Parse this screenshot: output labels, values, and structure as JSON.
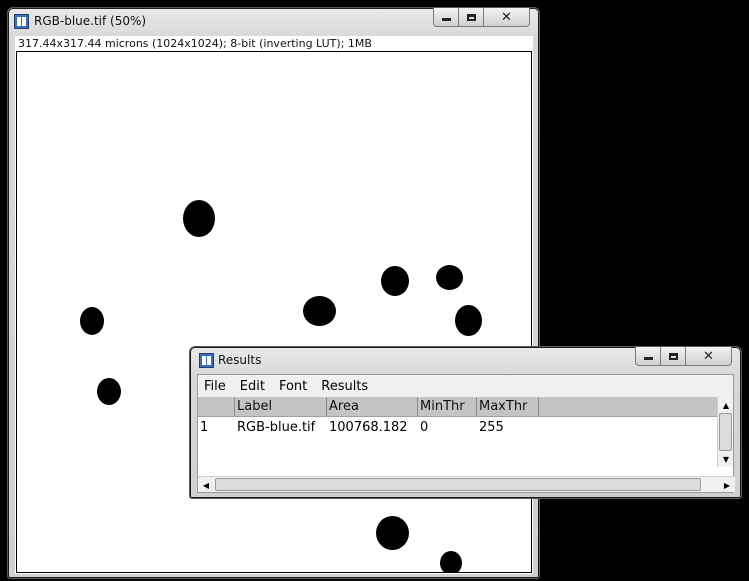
{
  "image_window": {
    "title": "RGB-blue.tif (50%)",
    "info": "317.44x317.44 microns (1024x1024); 8-bit (inverting LUT); 1MB"
  },
  "results_window": {
    "title": "Results",
    "menu": [
      "File",
      "Edit",
      "Font",
      "Results"
    ],
    "columns": [
      "",
      "Label",
      "Area",
      "MinThr",
      "MaxThr"
    ],
    "rows": [
      {
        "index": "1",
        "label": "RGB-blue.tif",
        "area": "100768.182",
        "minthr": "0",
        "maxthr": "255"
      }
    ]
  },
  "icons": {
    "app": "imagej-icon",
    "minimize": "minimize-icon",
    "maximize": "maximize-icon",
    "close": "close-icon"
  }
}
